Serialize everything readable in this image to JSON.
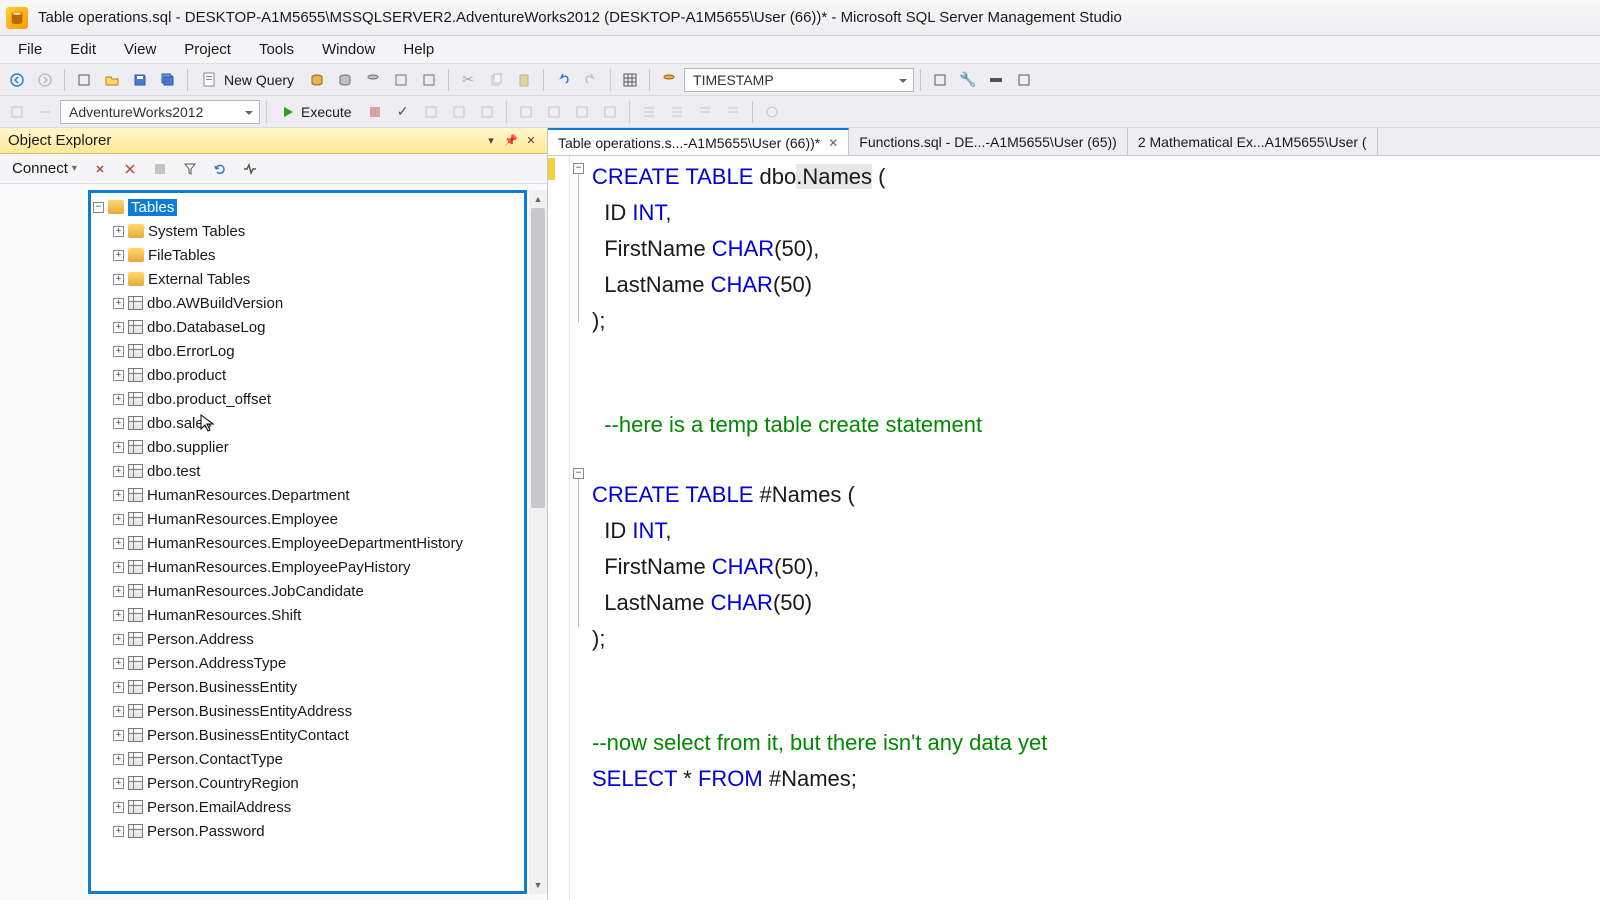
{
  "window": {
    "title": "Table operations.sql - DESKTOP-A1M5655\\MSSQLSERVER2.AdventureWorks2012 (DESKTOP-A1M5655\\User (66))* - Microsoft SQL Server Management Studio"
  },
  "menu": [
    "File",
    "Edit",
    "View",
    "Project",
    "Tools",
    "Window",
    "Help"
  ],
  "toolbar": {
    "new_query": "New Query",
    "execute": "Execute",
    "db_name": "AdventureWorks2012",
    "type_combo": "TIMESTAMP"
  },
  "explorer": {
    "title": "Object Explorer",
    "connect": "Connect",
    "root": "Tables",
    "folders": [
      "System Tables",
      "FileTables",
      "External Tables"
    ],
    "tables": [
      "dbo.AWBuildVersion",
      "dbo.DatabaseLog",
      "dbo.ErrorLog",
      "dbo.product",
      "dbo.product_offset",
      "dbo.sales",
      "dbo.supplier",
      "dbo.test",
      "HumanResources.Department",
      "HumanResources.Employee",
      "HumanResources.EmployeeDepartmentHistory",
      "HumanResources.EmployeePayHistory",
      "HumanResources.JobCandidate",
      "HumanResources.Shift",
      "Person.Address",
      "Person.AddressType",
      "Person.BusinessEntity",
      "Person.BusinessEntityAddress",
      "Person.BusinessEntityContact",
      "Person.ContactType",
      "Person.CountryRegion",
      "Person.EmailAddress",
      "Person.Password"
    ]
  },
  "tabs": [
    {
      "label": "Table operations.s...-A1M5655\\User (66))*",
      "active": true,
      "closable": true
    },
    {
      "label": "Functions.sql - DE...-A1M5655\\User (65))",
      "active": false,
      "closable": false
    },
    {
      "label": "2 Mathematical Ex...A1M5655\\User (",
      "active": false,
      "closable": false
    }
  ],
  "sql": {
    "l1_kw": "CREATE TABLE",
    "l1_rest": " dbo",
    "l1_hl": ".Names",
    "l1_end": " (",
    "l2a": "  ID ",
    "l2kw": "INT",
    "l2b": ",",
    "l3a": "  FirstName ",
    "l3kw": "CHAR",
    "l3b": "(50),",
    "l4a": "  LastName ",
    "l4kw": "CHAR",
    "l4b": "(50)",
    "l5": ");",
    "cm1": "  --here is a temp table create statement",
    "l6_kw": "CREATE TABLE",
    "l6_rest": " #Names (",
    "l7a": "  ID ",
    "l7kw": "INT",
    "l7b": ",",
    "l8a": "  FirstName ",
    "l8kw": "CHAR",
    "l8b": "(50),",
    "l9a": "  LastName ",
    "l9kw": "CHAR",
    "l9b": "(50)",
    "l10": ");",
    "cm2": "--now select from it, but there isn't any data yet",
    "l11kw1": "SELECT",
    "l11a": " * ",
    "l11kw2": "FROM",
    "l11b": " #Names;"
  }
}
